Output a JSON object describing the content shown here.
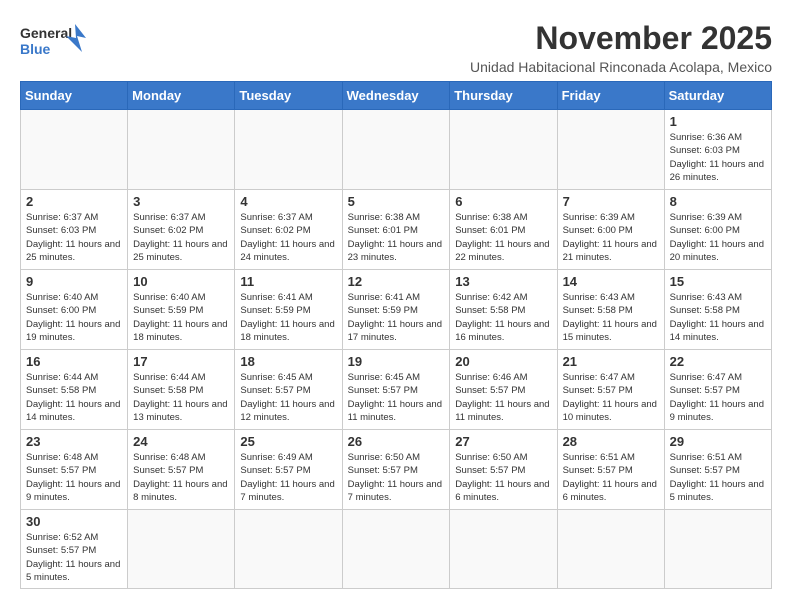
{
  "header": {
    "logo_general": "General",
    "logo_blue": "Blue",
    "month_title": "November 2025",
    "subtitle": "Unidad Habitacional Rinconada Acolapa, Mexico"
  },
  "days_of_week": [
    "Sunday",
    "Monday",
    "Tuesday",
    "Wednesday",
    "Thursday",
    "Friday",
    "Saturday"
  ],
  "weeks": [
    [
      {
        "day": "",
        "info": ""
      },
      {
        "day": "",
        "info": ""
      },
      {
        "day": "",
        "info": ""
      },
      {
        "day": "",
        "info": ""
      },
      {
        "day": "",
        "info": ""
      },
      {
        "day": "",
        "info": ""
      },
      {
        "day": "1",
        "info": "Sunrise: 6:36 AM\nSunset: 6:03 PM\nDaylight: 11 hours\nand 26 minutes."
      }
    ],
    [
      {
        "day": "2",
        "info": "Sunrise: 6:37 AM\nSunset: 6:03 PM\nDaylight: 11 hours\nand 25 minutes."
      },
      {
        "day": "3",
        "info": "Sunrise: 6:37 AM\nSunset: 6:02 PM\nDaylight: 11 hours\nand 25 minutes."
      },
      {
        "day": "4",
        "info": "Sunrise: 6:37 AM\nSunset: 6:02 PM\nDaylight: 11 hours\nand 24 minutes."
      },
      {
        "day": "5",
        "info": "Sunrise: 6:38 AM\nSunset: 6:01 PM\nDaylight: 11 hours\nand 23 minutes."
      },
      {
        "day": "6",
        "info": "Sunrise: 6:38 AM\nSunset: 6:01 PM\nDaylight: 11 hours\nand 22 minutes."
      },
      {
        "day": "7",
        "info": "Sunrise: 6:39 AM\nSunset: 6:00 PM\nDaylight: 11 hours\nand 21 minutes."
      },
      {
        "day": "8",
        "info": "Sunrise: 6:39 AM\nSunset: 6:00 PM\nDaylight: 11 hours\nand 20 minutes."
      }
    ],
    [
      {
        "day": "9",
        "info": "Sunrise: 6:40 AM\nSunset: 6:00 PM\nDaylight: 11 hours\nand 19 minutes."
      },
      {
        "day": "10",
        "info": "Sunrise: 6:40 AM\nSunset: 5:59 PM\nDaylight: 11 hours\nand 18 minutes."
      },
      {
        "day": "11",
        "info": "Sunrise: 6:41 AM\nSunset: 5:59 PM\nDaylight: 11 hours\nand 18 minutes."
      },
      {
        "day": "12",
        "info": "Sunrise: 6:41 AM\nSunset: 5:59 PM\nDaylight: 11 hours\nand 17 minutes."
      },
      {
        "day": "13",
        "info": "Sunrise: 6:42 AM\nSunset: 5:58 PM\nDaylight: 11 hours\nand 16 minutes."
      },
      {
        "day": "14",
        "info": "Sunrise: 6:43 AM\nSunset: 5:58 PM\nDaylight: 11 hours\nand 15 minutes."
      },
      {
        "day": "15",
        "info": "Sunrise: 6:43 AM\nSunset: 5:58 PM\nDaylight: 11 hours\nand 14 minutes."
      }
    ],
    [
      {
        "day": "16",
        "info": "Sunrise: 6:44 AM\nSunset: 5:58 PM\nDaylight: 11 hours\nand 14 minutes."
      },
      {
        "day": "17",
        "info": "Sunrise: 6:44 AM\nSunset: 5:58 PM\nDaylight: 11 hours\nand 13 minutes."
      },
      {
        "day": "18",
        "info": "Sunrise: 6:45 AM\nSunset: 5:57 PM\nDaylight: 11 hours\nand 12 minutes."
      },
      {
        "day": "19",
        "info": "Sunrise: 6:45 AM\nSunset: 5:57 PM\nDaylight: 11 hours\nand 11 minutes."
      },
      {
        "day": "20",
        "info": "Sunrise: 6:46 AM\nSunset: 5:57 PM\nDaylight: 11 hours\nand 11 minutes."
      },
      {
        "day": "21",
        "info": "Sunrise: 6:47 AM\nSunset: 5:57 PM\nDaylight: 11 hours\nand 10 minutes."
      },
      {
        "day": "22",
        "info": "Sunrise: 6:47 AM\nSunset: 5:57 PM\nDaylight: 11 hours\nand 9 minutes."
      }
    ],
    [
      {
        "day": "23",
        "info": "Sunrise: 6:48 AM\nSunset: 5:57 PM\nDaylight: 11 hours\nand 9 minutes."
      },
      {
        "day": "24",
        "info": "Sunrise: 6:48 AM\nSunset: 5:57 PM\nDaylight: 11 hours\nand 8 minutes."
      },
      {
        "day": "25",
        "info": "Sunrise: 6:49 AM\nSunset: 5:57 PM\nDaylight: 11 hours\nand 7 minutes."
      },
      {
        "day": "26",
        "info": "Sunrise: 6:50 AM\nSunset: 5:57 PM\nDaylight: 11 hours\nand 7 minutes."
      },
      {
        "day": "27",
        "info": "Sunrise: 6:50 AM\nSunset: 5:57 PM\nDaylight: 11 hours\nand 6 minutes."
      },
      {
        "day": "28",
        "info": "Sunrise: 6:51 AM\nSunset: 5:57 PM\nDaylight: 11 hours\nand 6 minutes."
      },
      {
        "day": "29",
        "info": "Sunrise: 6:51 AM\nSunset: 5:57 PM\nDaylight: 11 hours\nand 5 minutes."
      }
    ],
    [
      {
        "day": "30",
        "info": "Sunrise: 6:52 AM\nSunset: 5:57 PM\nDaylight: 11 hours\nand 5 minutes."
      },
      {
        "day": "",
        "info": ""
      },
      {
        "day": "",
        "info": ""
      },
      {
        "day": "",
        "info": ""
      },
      {
        "day": "",
        "info": ""
      },
      {
        "day": "",
        "info": ""
      },
      {
        "day": "",
        "info": ""
      }
    ]
  ]
}
